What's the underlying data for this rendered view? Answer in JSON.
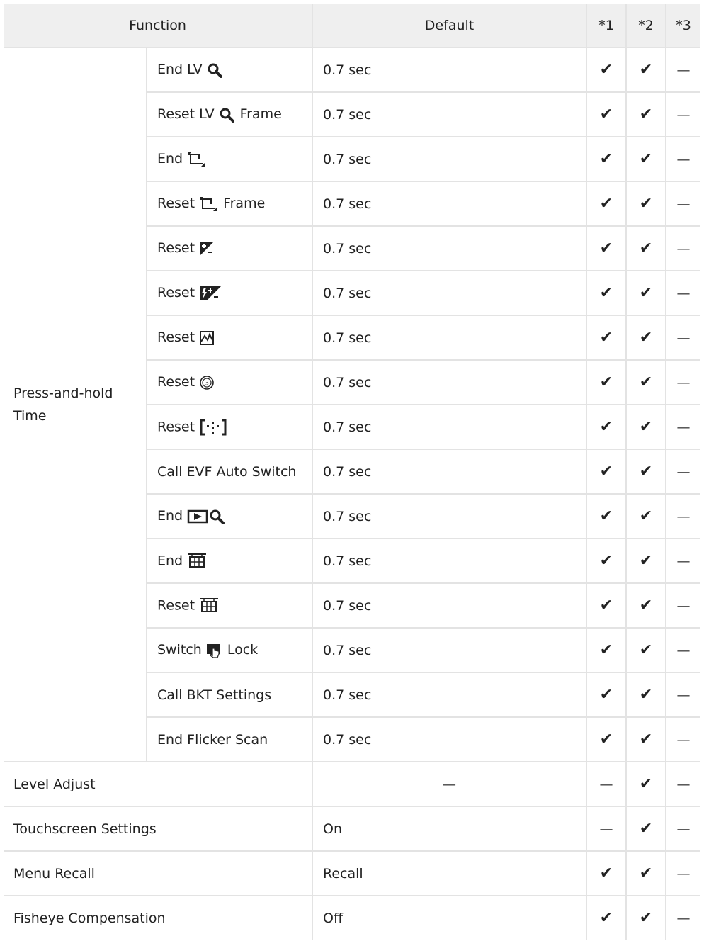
{
  "header": {
    "function": "Function",
    "default": "Default",
    "c1": "*1",
    "c2": "*2",
    "c3": "*3"
  },
  "marks": {
    "check": "✔",
    "dash": "—"
  },
  "group_label": "Press-and-hold Time",
  "sub_rows": [
    {
      "prefix": "End LV",
      "icon": "magnify-icon",
      "suffix": "",
      "default": "0.7 sec",
      "c1": "✔",
      "c2": "✔",
      "c3": "—"
    },
    {
      "prefix": "Reset LV",
      "icon": "magnify-icon",
      "suffix": "Frame",
      "default": "0.7 sec",
      "c1": "✔",
      "c2": "✔",
      "c3": "—"
    },
    {
      "prefix": "End",
      "icon": "crop-icon",
      "suffix": "",
      "default": "0.7 sec",
      "c1": "✔",
      "c2": "✔",
      "c3": "—"
    },
    {
      "prefix": "Reset",
      "icon": "crop-icon",
      "suffix": "Frame",
      "default": "0.7 sec",
      "c1": "✔",
      "c2": "✔",
      "c3": "—"
    },
    {
      "prefix": "Reset",
      "icon": "exposure-comp-icon",
      "suffix": "",
      "default": "0.7 sec",
      "c1": "✔",
      "c2": "✔",
      "c3": "—"
    },
    {
      "prefix": "Reset",
      "icon": "flash-comp-icon",
      "suffix": "",
      "default": "0.7 sec",
      "c1": "✔",
      "c2": "✔",
      "c3": "—"
    },
    {
      "prefix": "Reset",
      "icon": "tone-curve-icon",
      "suffix": "",
      "default": "0.7 sec",
      "c1": "✔",
      "c2": "✔",
      "c3": "—"
    },
    {
      "prefix": "Reset",
      "icon": "self-timer-icon",
      "suffix": "",
      "default": "0.7 sec",
      "c1": "✔",
      "c2": "✔",
      "c3": "—"
    },
    {
      "prefix": "Reset",
      "icon": "af-target-icon",
      "suffix": "",
      "default": "0.7 sec",
      "c1": "✔",
      "c2": "✔",
      "c3": "—"
    },
    {
      "prefix": "Call EVF Auto Switch",
      "icon": "",
      "suffix": "",
      "default": "0.7 sec",
      "c1": "✔",
      "c2": "✔",
      "c3": "—"
    },
    {
      "prefix": "End",
      "icon": "playback-magnify-icon",
      "suffix": "",
      "default": "0.7 sec",
      "c1": "✔",
      "c2": "✔",
      "c3": "—"
    },
    {
      "prefix": "End",
      "icon": "grid-icon",
      "suffix": "",
      "default": "0.7 sec",
      "c1": "✔",
      "c2": "✔",
      "c3": "—"
    },
    {
      "prefix": "Reset",
      "icon": "grid-icon",
      "suffix": "",
      "default": "0.7 sec",
      "c1": "✔",
      "c2": "✔",
      "c3": "—"
    },
    {
      "prefix": "Switch",
      "icon": "touch-lock-icon",
      "suffix": "Lock",
      "default": "0.7 sec",
      "c1": "✔",
      "c2": "✔",
      "c3": "—"
    },
    {
      "prefix": "Call BKT Settings",
      "icon": "",
      "suffix": "",
      "default": "0.7 sec",
      "c1": "✔",
      "c2": "✔",
      "c3": "—"
    },
    {
      "prefix": "End Flicker Scan",
      "icon": "",
      "suffix": "",
      "default": "0.7 sec",
      "c1": "✔",
      "c2": "✔",
      "c3": "—"
    }
  ],
  "rows": [
    {
      "function": "Level Adjust",
      "default": "—",
      "c1": "—",
      "c2": "✔",
      "c3": "—"
    },
    {
      "function": "Touchscreen Settings",
      "default": "On",
      "c1": "—",
      "c2": "✔",
      "c3": "—"
    },
    {
      "function": "Menu Recall",
      "default": "Recall",
      "c1": "✔",
      "c2": "✔",
      "c3": "—"
    },
    {
      "function": "Fisheye Compensation",
      "default": "Off",
      "c1": "✔",
      "c2": "✔",
      "c3": "—"
    }
  ]
}
